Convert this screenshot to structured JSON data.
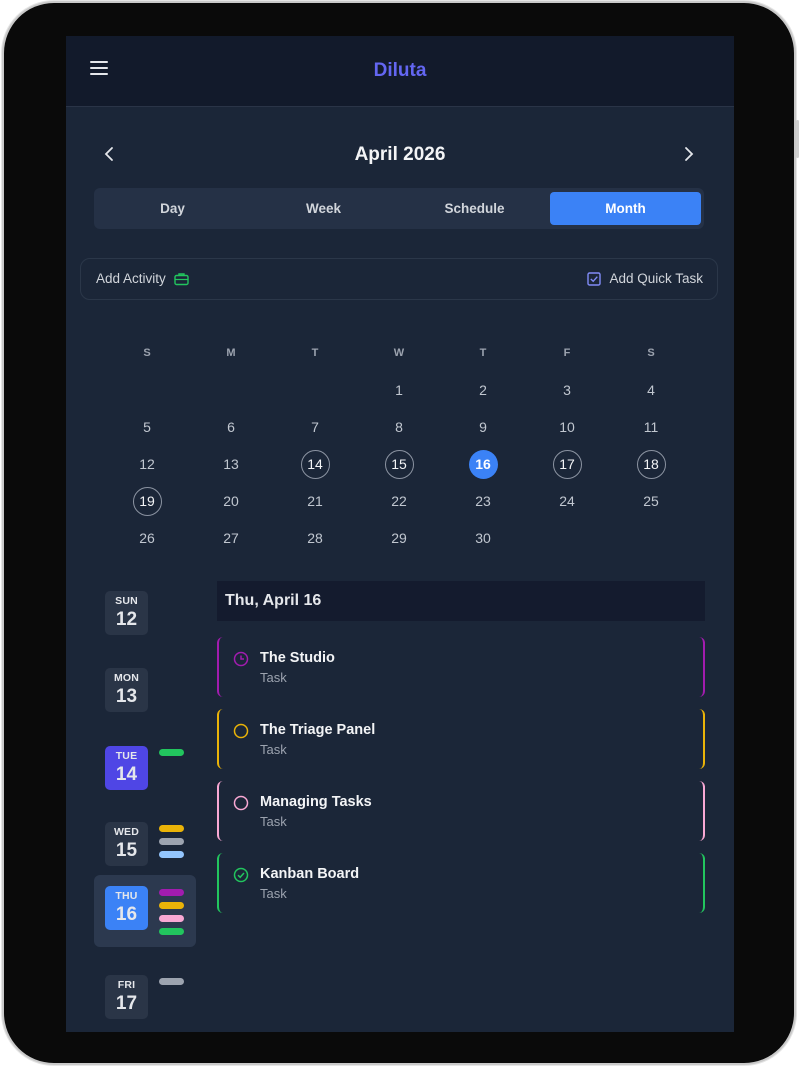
{
  "header": {
    "app_title": "Diluta"
  },
  "nav": {
    "month_title": "April 2026"
  },
  "views": {
    "tabs": [
      {
        "label": "Day",
        "active": false
      },
      {
        "label": "Week",
        "active": false
      },
      {
        "label": "Schedule",
        "active": false
      },
      {
        "label": "Month",
        "active": true
      }
    ]
  },
  "actions": {
    "add_activity": "Add Activity",
    "add_quick_task": "Add Quick Task"
  },
  "calendar": {
    "weekday_labels": [
      "S",
      "M",
      "T",
      "W",
      "T",
      "F",
      "S"
    ],
    "weeks": [
      [
        "",
        "",
        "",
        "1",
        "2",
        "3",
        "4"
      ],
      [
        "5",
        "6",
        "7",
        "8",
        "9",
        "10",
        "11"
      ],
      [
        "12",
        "13",
        "14",
        "15",
        "16",
        "17",
        "18"
      ],
      [
        "19",
        "20",
        "21",
        "22",
        "23",
        "24",
        "25"
      ],
      [
        "26",
        "27",
        "28",
        "29",
        "30",
        "",
        ""
      ]
    ],
    "ringed_days": [
      "14",
      "15",
      "17",
      "18",
      "19"
    ],
    "selected_day": "16"
  },
  "day_strip": [
    {
      "weekday": "SUN",
      "day": "12",
      "state": "normal",
      "dots": []
    },
    {
      "weekday": "MON",
      "day": "13",
      "state": "normal",
      "dots": []
    },
    {
      "weekday": "TUE",
      "day": "14",
      "state": "today",
      "dots": [
        "#22c55e"
      ]
    },
    {
      "weekday": "WED",
      "day": "15",
      "state": "normal",
      "dots": [
        "#eab308",
        "#9ca3af",
        "#93c5fd"
      ]
    },
    {
      "weekday": "THU",
      "day": "16",
      "state": "selected",
      "dots": [
        "#a21caf",
        "#eab308",
        "#f9a8d4",
        "#22c55e"
      ]
    },
    {
      "weekday": "FRI",
      "day": "17",
      "state": "normal",
      "dots": [
        "#9ca3af"
      ]
    }
  ],
  "agenda": {
    "date_heading": "Thu, April 16",
    "tasks": [
      {
        "title": "The Studio",
        "type": "Task",
        "color": "#a21caf",
        "icon": "clock-icon"
      },
      {
        "title": "The Triage Panel",
        "type": "Task",
        "color": "#eab308",
        "icon": "circle-icon"
      },
      {
        "title": "Managing Tasks",
        "type": "Task",
        "color": "#f9a8d4",
        "icon": "circle-icon"
      },
      {
        "title": "Kanban Board",
        "type": "Task",
        "color": "#22c55e",
        "icon": "check-circle-icon"
      }
    ]
  },
  "colors": {
    "accent": "#3b82f6",
    "brand": "#6366f1",
    "background": "#1b2638",
    "header": "#121a2b",
    "today": "#4f46e5"
  }
}
